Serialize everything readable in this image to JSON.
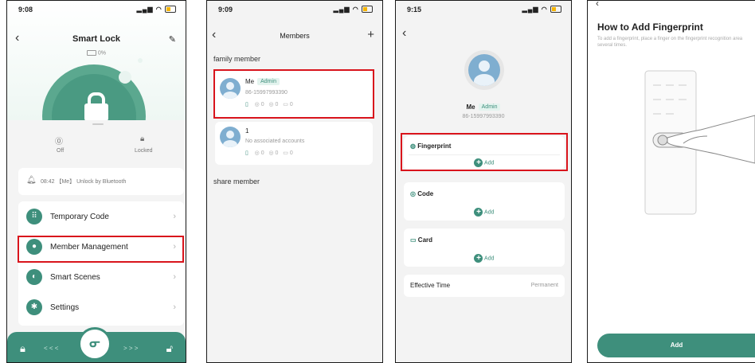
{
  "colors": {
    "accent": "#3e8f7c",
    "highlight": "#d9141c",
    "avatar": "#7faed0"
  },
  "screen1": {
    "time": "9:08",
    "title": "Smart Lock",
    "battery": "0%",
    "status_off": "Off",
    "status_locked": "Locked",
    "log": "08:42 【Me】 Unlock by Bluetooth",
    "menu": [
      {
        "label": "Temporary Code",
        "icon": "keypad-icon"
      },
      {
        "label": "Member Management",
        "icon": "person-icon"
      },
      {
        "label": "Smart Scenes",
        "icon": "toggle-icon"
      },
      {
        "label": "Settings",
        "icon": "gear-icon"
      }
    ],
    "bottom_lock_arrows": "< < <",
    "bottom_unlock_arrows": "> > >"
  },
  "screen2": {
    "time": "9:09",
    "title": "Members",
    "add": "+",
    "section_family": "family member",
    "member1": {
      "name": "Me",
      "badge": "Admin",
      "phone": "86-15997993390",
      "counts": [
        "0",
        "0",
        "0"
      ]
    },
    "member2": {
      "name": "1",
      "note": "No associated accounts",
      "counts": [
        "0",
        "0",
        "0"
      ]
    },
    "section_share": "share member"
  },
  "screen3": {
    "time": "9:15",
    "name": "Me",
    "badge": "Admin",
    "phone": "86-15997993390",
    "fingerprint_label": "Fingerprint",
    "code_label": "Code",
    "card_label": "Card",
    "add_label": "Add",
    "effective_label": "Effective Time",
    "effective_value": "Permanent"
  },
  "screen4": {
    "title": "How to Add Fingerprint",
    "instructions": "To add a fingerprint, place a finger on the fingerprint recognition area several times.",
    "add_button": "Add"
  }
}
